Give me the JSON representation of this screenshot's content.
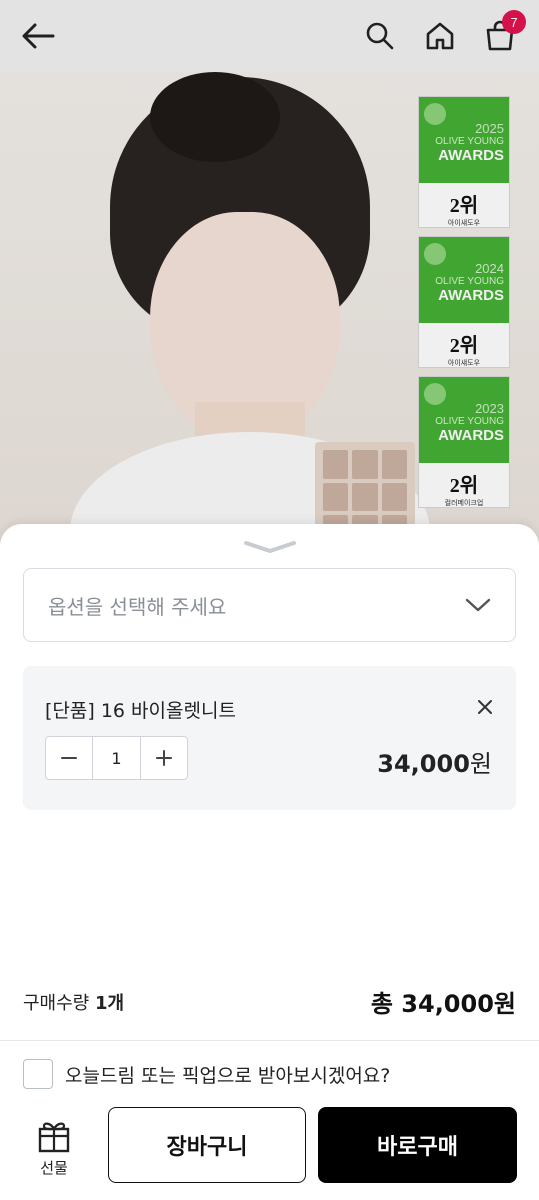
{
  "header": {
    "cart_count": "7",
    "icons": [
      "back-arrow-icon",
      "search-icon",
      "home-icon",
      "shopping-bag-icon"
    ]
  },
  "awards": [
    {
      "year": "2025",
      "brand": "OLIVE YOUNG",
      "title": "AWARDS",
      "rank": "2위",
      "category": "아이섀도우"
    },
    {
      "year": "2024",
      "brand": "OLIVE YOUNG",
      "title": "AWARDS",
      "rank": "2위",
      "category": "아이섀도우"
    },
    {
      "year": "2023",
      "brand": "OLIVE YOUNG",
      "title": "AWARDS",
      "rank": "2위",
      "category": "컬러메이크업"
    }
  ],
  "sheet": {
    "select_placeholder": "옵션을 선택해 주세요",
    "option": {
      "name": "[단품] 16 바이올렛니트",
      "quantity": "1",
      "price_number": "34,000",
      "price_unit": "원"
    },
    "quantity_label": "구매수량",
    "quantity_value": "1개",
    "total_label": "총 34,000원",
    "pickup_text": "오늘드림 또는 픽업으로 받아보시겠어요?",
    "gift_label": "선물",
    "cart_label": "장바구니",
    "buy_label": "바로구매"
  },
  "colors": {
    "badge": "#e2134f",
    "award_green": "#46b035",
    "buy_button": "#000000"
  }
}
